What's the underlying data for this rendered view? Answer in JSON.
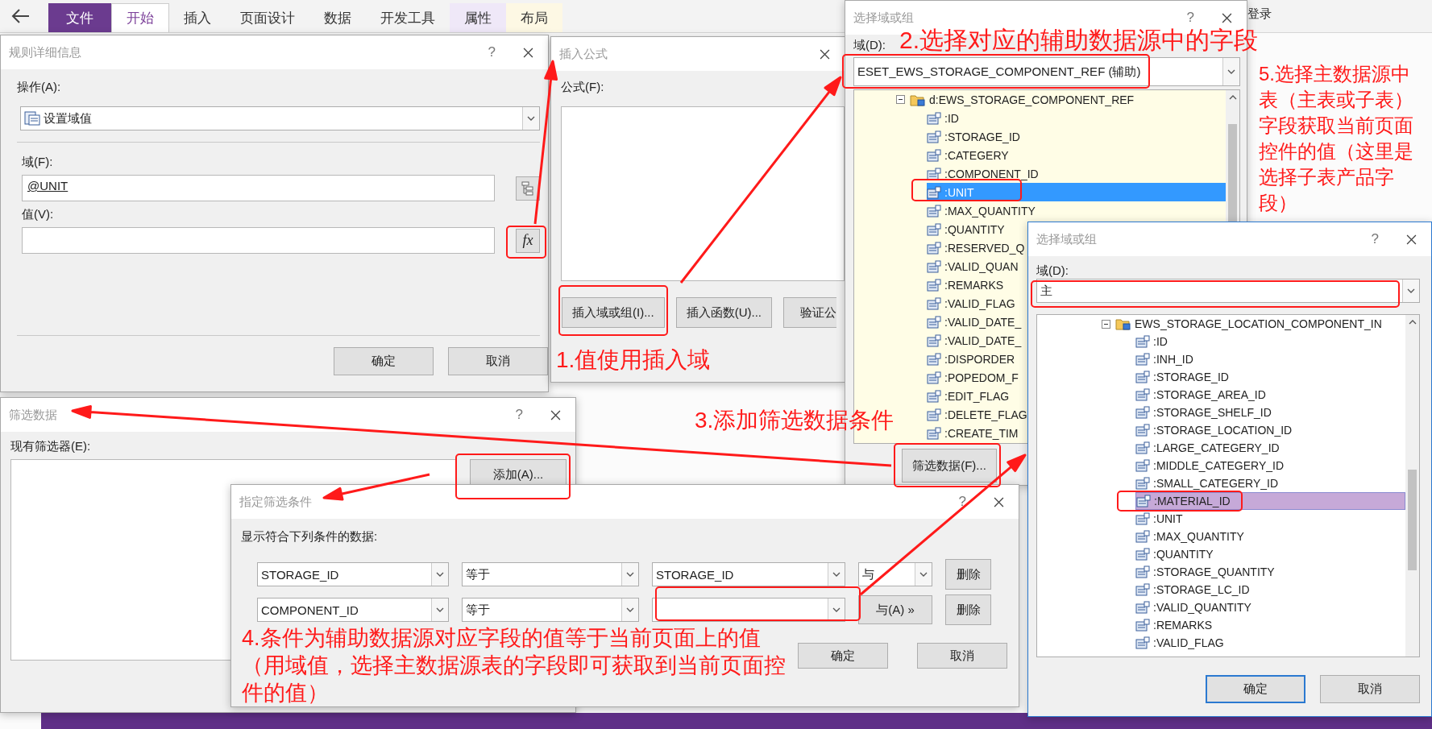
{
  "ribbon": {
    "tabs": [
      {
        "label": "文件",
        "kind": "file",
        "selected": false
      },
      {
        "label": "开始",
        "kind": "tab",
        "selected": true
      },
      {
        "label": "插入",
        "kind": "tab",
        "selected": false
      },
      {
        "label": "页面设计",
        "kind": "tab",
        "selected": false
      },
      {
        "label": "数据",
        "kind": "tab",
        "selected": false
      },
      {
        "label": "开发工具",
        "kind": "tab",
        "selected": false
      },
      {
        "label": "属性",
        "kind": "contextual",
        "color": "#efe8f8",
        "selected": false
      },
      {
        "label": "布局",
        "kind": "contextual",
        "color": "#fdf8e4",
        "selected": false
      }
    ],
    "sign_in": "登录"
  },
  "rule_dialog": {
    "title": "规则详细信息",
    "help": "?",
    "action_label": "操作(A):",
    "action_value": "设置域值",
    "field_label": "域(F):",
    "field_value": "@UNIT",
    "value_label": "值(V):",
    "formula_button": "fx",
    "buttons": [
      "确定",
      "取消"
    ]
  },
  "formula_dialog": {
    "title": "插入公式",
    "formula_label": "公式(F):",
    "buttons": [
      "插入域或组(I)...",
      "插入函数(U)...",
      "验证公"
    ]
  },
  "field_dialog_aux": {
    "title": "选择域或组",
    "help": "?",
    "field_label": "域(D):",
    "data_source": "ESET_EWS_STORAGE_COMPONENT_REF (辅助)",
    "tree": {
      "label": "d:EWS_STORAGE_COMPONENT_REF",
      "expanded": true,
      "children": [
        {
          "label": ":ID",
          "selected": false
        },
        {
          "label": ":STORAGE_ID",
          "selected": false
        },
        {
          "label": ":CATEGERY",
          "selected": false
        },
        {
          "label": ":COMPONENT_ID",
          "selected": false
        },
        {
          "label": ":UNIT",
          "selected": true
        },
        {
          "label": ":MAX_QUANTITY",
          "selected": false
        },
        {
          "label": ":QUANTITY",
          "selected": false
        },
        {
          "label": ":RESERVED_Q",
          "selected": false
        },
        {
          "label": ":VALID_QUAN",
          "selected": false
        },
        {
          "label": ":REMARKS",
          "selected": false
        },
        {
          "label": ":VALID_FLAG",
          "selected": false
        },
        {
          "label": ":VALID_DATE_",
          "selected": false
        },
        {
          "label": ":VALID_DATE_",
          "selected": false
        },
        {
          "label": ":DISPORDER",
          "selected": false
        },
        {
          "label": ":POPEDOM_F",
          "selected": false
        },
        {
          "label": ":EDIT_FLAG",
          "selected": false
        },
        {
          "label": ":DELETE_FLAG",
          "selected": false
        },
        {
          "label": ":CREATE_TIM",
          "selected": false
        }
      ]
    },
    "buttons": [
      "筛选数据(F)..."
    ]
  },
  "filter_dialog": {
    "title": "筛选数据",
    "help": "?",
    "filters_label": "现有筛选器(E):",
    "add_button": "添加(A)..."
  },
  "condition_dialog": {
    "title": "指定筛选条件",
    "help": "?",
    "caption": "显示符合下列条件的数据:",
    "rows": [
      {
        "field": "STORAGE_ID",
        "operator": "等于",
        "value": "STORAGE_ID",
        "conjunction": {
          "kind": "select",
          "label": "与"
        },
        "delete": "删除"
      },
      {
        "field": "COMPONENT_ID",
        "operator": "等于",
        "conjunction": {
          "kind": "button",
          "label": "与(A) »"
        },
        "delete": "删除"
      }
    ],
    "buttons": [
      "确定",
      "取消"
    ]
  },
  "field_dialog_main": {
    "title": "选择域或组",
    "help": "?",
    "field_label": "域(D):",
    "data_source": "主",
    "tree": {
      "label": "EWS_STORAGE_LOCATION_COMPONENT_IN",
      "expanded": true,
      "children": [
        {
          "label": ":ID",
          "selected": false
        },
        {
          "label": ":INH_ID",
          "selected": false
        },
        {
          "label": ":STORAGE_ID",
          "selected": false
        },
        {
          "label": ":STORAGE_AREA_ID",
          "selected": false
        },
        {
          "label": ":STORAGE_SHELF_ID",
          "selected": false
        },
        {
          "label": ":STORAGE_LOCATION_ID",
          "selected": false
        },
        {
          "label": ":LARGE_CATEGERY_ID",
          "selected": false
        },
        {
          "label": ":MIDDLE_CATEGERY_ID",
          "selected": false
        },
        {
          "label": ":SMALL_CATEGERY_ID",
          "selected": false
        },
        {
          "label": ":MATERIAL_ID",
          "selected": true
        },
        {
          "label": ":UNIT",
          "selected": false
        },
        {
          "label": ":MAX_QUANTITY",
          "selected": false
        },
        {
          "label": ":QUANTITY",
          "selected": false
        },
        {
          "label": ":STORAGE_QUANTITY",
          "selected": false
        },
        {
          "label": ":STORAGE_LC_ID",
          "selected": false
        },
        {
          "label": ":VALID_QUANTITY",
          "selected": false
        },
        {
          "label": ":REMARKS",
          "selected": false
        },
        {
          "label": ":VALID_FLAG",
          "selected": false
        }
      ]
    },
    "buttons": [
      "确定",
      "取消"
    ]
  },
  "annotations": [
    {
      "text": "1.值使用插入域"
    },
    {
      "text": "2.选择对应的辅助数据源中的字段"
    },
    {
      "text": "3.添加筛选数据条件"
    },
    {
      "text": "4.条件为辅助数据源对应字段的值等于当前页面上的值（用域值，选择主数据源表的字段即可获取到当前页面控件的值）"
    },
    {
      "text": "5.选择主数据源中表（主表或子表）字段获取当前页面控件的值（这里是选择子表产品字段）"
    }
  ]
}
